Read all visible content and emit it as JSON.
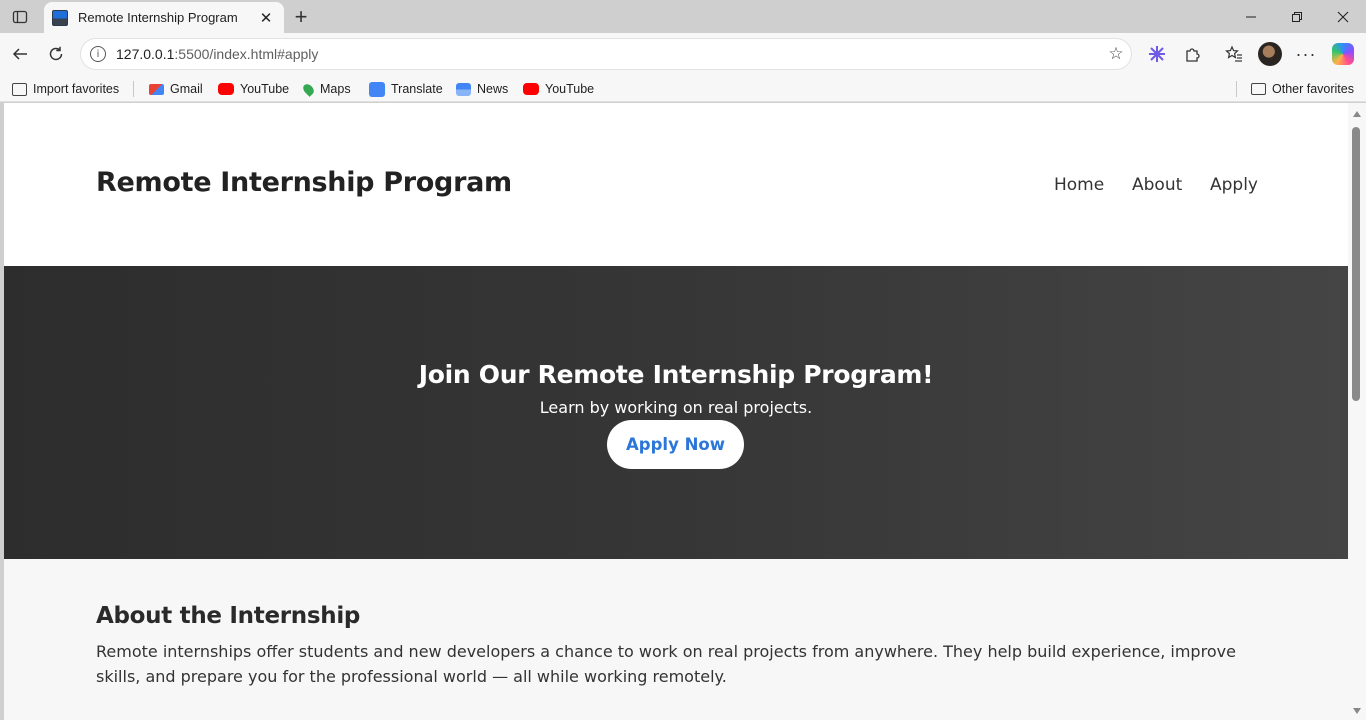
{
  "browser": {
    "tab_title": "Remote Internship Program",
    "url_host": "127.0.0.1",
    "url_rest": ":5500/index.html#apply",
    "bookmarks": [
      {
        "label": "Import favorites",
        "icon": "import-icon"
      },
      {
        "label": "Gmail",
        "icon": "gmail-icon"
      },
      {
        "label": "YouTube",
        "icon": "youtube-icon"
      },
      {
        "label": "Maps",
        "icon": "maps-icon"
      },
      {
        "label": "Translate",
        "icon": "translate-icon"
      },
      {
        "label": "News",
        "icon": "news-icon"
      },
      {
        "label": "YouTube",
        "icon": "youtube-icon"
      }
    ],
    "other_favorites": "Other favorites"
  },
  "site": {
    "logo": "Remote Internship Program",
    "nav": [
      "Home",
      "About",
      "Apply"
    ]
  },
  "hero": {
    "title": "Join Our Remote Internship Program!",
    "subtitle": "Learn by working on real projects.",
    "cta": "Apply Now"
  },
  "about": {
    "title": "About the Internship",
    "text": "Remote internships offer students and new developers a chance to work on real projects from anywhere. They help build experience, improve skills, and prepare you for the professional world — all while working remotely."
  },
  "colors": {
    "cta_text": "#2b76d8",
    "hero_bg": "#363636",
    "about_bg": "#f7f7f7"
  }
}
